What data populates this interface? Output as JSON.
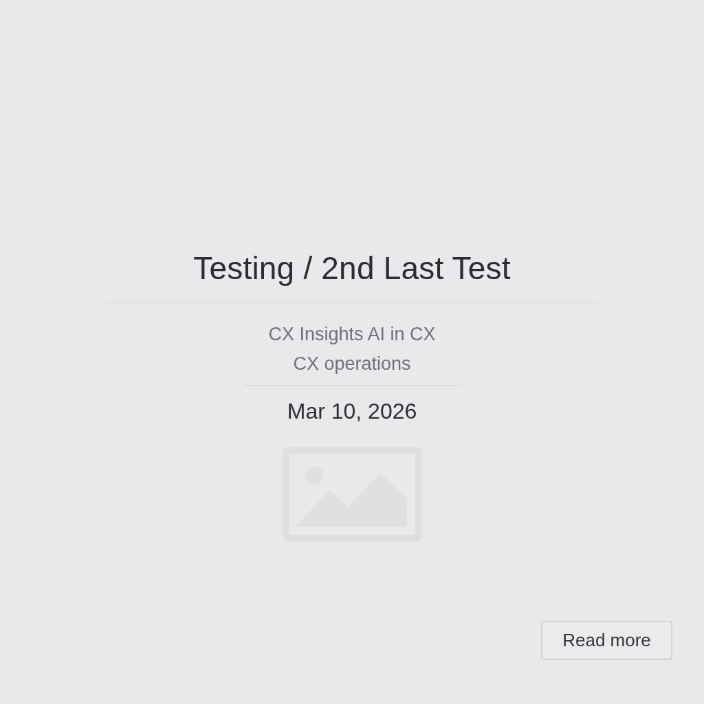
{
  "title": "Testing / 2nd Last Test",
  "subtitle_lines": [
    "CX Insights AI in CX",
    "CX operations"
  ],
  "date": "Mar 10, 2026",
  "read_more_button": {
    "label": "Read more"
  }
}
